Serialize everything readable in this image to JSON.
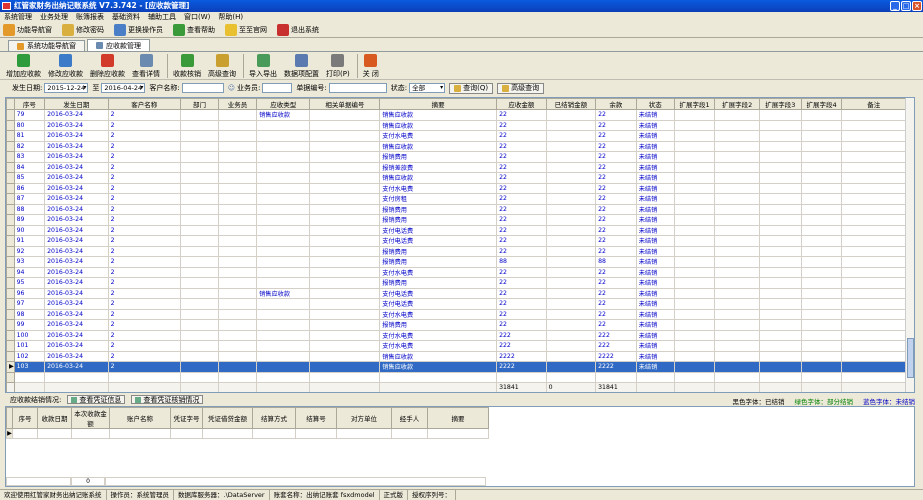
{
  "window": {
    "title": "红管家财务出纳记账系统 V7.3.742 - [应收款管理]"
  },
  "menu": [
    "系统管理",
    "业务处理",
    "账簿报表",
    "基础资料",
    "辅助工具",
    "窗口(W)",
    "帮助(H)"
  ],
  "mainbar": [
    {
      "label": "功能导航窗",
      "icon": "home-icon",
      "color": "#e39a2a"
    },
    {
      "label": "修改密码",
      "icon": "key-icon",
      "color": "#d9b040"
    },
    {
      "label": "更换操作员",
      "icon": "users-icon",
      "color": "#4a7fc8"
    },
    {
      "label": "查看帮助",
      "icon": "help-icon",
      "color": "#3a9a3a"
    },
    {
      "label": "至至官网",
      "icon": "star-icon",
      "color": "#e8c030"
    },
    {
      "label": "退出系统",
      "icon": "exit-icon",
      "color": "#c83030"
    }
  ],
  "tabs": [
    {
      "label": "系统功能导航窗",
      "icon": "home-icon",
      "active": false
    },
    {
      "label": "应收款管理",
      "icon": "document-icon",
      "active": true
    }
  ],
  "toolbar": [
    {
      "label": "增加应收款",
      "icon": "add-icon",
      "color": "#2e9c3c"
    },
    {
      "label": "修改应收款",
      "icon": "edit-icon",
      "color": "#3b7bc8"
    },
    {
      "label": "删除应收款",
      "icon": "delete-icon",
      "color": "#d23a2a"
    },
    {
      "label": "查看详情",
      "icon": "details-icon",
      "color": "#6a8ab0"
    },
    {
      "label": "收款核销",
      "icon": "writeoff-icon",
      "color": "#3a9a3a"
    },
    {
      "label": "高级查询",
      "icon": "advanced-search-icon",
      "color": "#c9a030"
    },
    {
      "label": "导入导出",
      "icon": "import-export-icon",
      "color": "#4a9a5a"
    },
    {
      "label": "数据项配置",
      "icon": "settings-icon",
      "color": "#5a7ab0"
    },
    {
      "label": "打印(P)",
      "icon": "print-icon",
      "color": "#7a7a7a"
    },
    {
      "label": "关 闭",
      "icon": "close-icon",
      "color": "#d85a20"
    }
  ],
  "filter": {
    "date_label": "发生日期:",
    "date_from": "2015-12-24",
    "to_label": "至",
    "date_to": "2016-04-24",
    "customer_label": "客户名称:",
    "customer_value": "",
    "salesperson_label": "业务员:",
    "salesperson_value": "",
    "docno_label": "单据编号:",
    "docno_value": "",
    "status_label": "状态:",
    "status_value": "全部",
    "query_btn": "查询(Q)",
    "adv_btn": "高级查询"
  },
  "grid": {
    "columns": [
      "序号",
      "发生日期",
      "客户名称",
      "部门",
      "业务员",
      "应收类型",
      "相关单据编号",
      "摘要",
      "应收金额",
      "已结销金额",
      "余款",
      "状态",
      "扩展字段1",
      "扩展字段2",
      "扩展字段3",
      "扩展字段4",
      "备注"
    ],
    "rows": [
      {
        "no": "79",
        "date": "2016-03-24",
        "cust": "2",
        "type": "销售应收款",
        "summary": "销售应收款",
        "amt": "22",
        "paid": "",
        "bal": "22",
        "status": "未结销"
      },
      {
        "no": "80",
        "date": "2016-03-24",
        "cust": "2",
        "type": "",
        "summary": "销售应收款",
        "amt": "22",
        "paid": "",
        "bal": "22",
        "status": "未结销"
      },
      {
        "no": "81",
        "date": "2016-03-24",
        "cust": "2",
        "type": "",
        "summary": "支付水电费",
        "amt": "22",
        "paid": "",
        "bal": "22",
        "status": "未结销"
      },
      {
        "no": "82",
        "date": "2016-03-24",
        "cust": "2",
        "type": "",
        "summary": "销售应收款",
        "amt": "22",
        "paid": "",
        "bal": "22",
        "status": "未结销"
      },
      {
        "no": "83",
        "date": "2016-03-24",
        "cust": "2",
        "type": "",
        "summary": "报销费用",
        "amt": "22",
        "paid": "",
        "bal": "22",
        "status": "未结销"
      },
      {
        "no": "84",
        "date": "2016-03-24",
        "cust": "2",
        "type": "",
        "summary": "报销差旅费",
        "amt": "22",
        "paid": "",
        "bal": "22",
        "status": "未结销"
      },
      {
        "no": "85",
        "date": "2016-03-24",
        "cust": "2",
        "type": "",
        "summary": "销售应收款",
        "amt": "22",
        "paid": "",
        "bal": "22",
        "status": "未结销"
      },
      {
        "no": "86",
        "date": "2016-03-24",
        "cust": "2",
        "type": "",
        "summary": "支付水电费",
        "amt": "22",
        "paid": "",
        "bal": "22",
        "status": "未结销"
      },
      {
        "no": "87",
        "date": "2016-03-24",
        "cust": "2",
        "type": "",
        "summary": "支付房租",
        "amt": "22",
        "paid": "",
        "bal": "22",
        "status": "未结销"
      },
      {
        "no": "88",
        "date": "2016-03-24",
        "cust": "2",
        "type": "",
        "summary": "报销费用",
        "amt": "22",
        "paid": "",
        "bal": "22",
        "status": "未结销"
      },
      {
        "no": "89",
        "date": "2016-03-24",
        "cust": "2",
        "type": "",
        "summary": "报销费用",
        "amt": "22",
        "paid": "",
        "bal": "22",
        "status": "未结销"
      },
      {
        "no": "90",
        "date": "2016-03-24",
        "cust": "2",
        "type": "",
        "summary": "支付电话费",
        "amt": "22",
        "paid": "",
        "bal": "22",
        "status": "未结销"
      },
      {
        "no": "91",
        "date": "2016-03-24",
        "cust": "2",
        "type": "",
        "summary": "支付电话费",
        "amt": "22",
        "paid": "",
        "bal": "22",
        "status": "未结销"
      },
      {
        "no": "92",
        "date": "2016-03-24",
        "cust": "2",
        "type": "",
        "summary": "报销费用",
        "amt": "22",
        "paid": "",
        "bal": "22",
        "status": "未结销"
      },
      {
        "no": "93",
        "date": "2016-03-24",
        "cust": "2",
        "type": "",
        "summary": "报销费用",
        "amt": "88",
        "paid": "",
        "bal": "88",
        "status": "未结销"
      },
      {
        "no": "94",
        "date": "2016-03-24",
        "cust": "2",
        "type": "",
        "summary": "支付水电费",
        "amt": "22",
        "paid": "",
        "bal": "22",
        "status": "未结销"
      },
      {
        "no": "95",
        "date": "2016-03-24",
        "cust": "2",
        "type": "",
        "summary": "报销费用",
        "amt": "22",
        "paid": "",
        "bal": "22",
        "status": "未结销"
      },
      {
        "no": "96",
        "date": "2016-03-24",
        "cust": "2",
        "type": "销售应收款",
        "summary": "支付电话费",
        "amt": "22",
        "paid": "",
        "bal": "22",
        "status": "未结销"
      },
      {
        "no": "97",
        "date": "2016-03-24",
        "cust": "2",
        "type": "",
        "summary": "支付电话费",
        "amt": "22",
        "paid": "",
        "bal": "22",
        "status": "未结销"
      },
      {
        "no": "98",
        "date": "2016-03-24",
        "cust": "2",
        "type": "",
        "summary": "支付水电费",
        "amt": "22",
        "paid": "",
        "bal": "22",
        "status": "未结销"
      },
      {
        "no": "99",
        "date": "2016-03-24",
        "cust": "2",
        "type": "",
        "summary": "报销费用",
        "amt": "22",
        "paid": "",
        "bal": "22",
        "status": "未结销"
      },
      {
        "no": "100",
        "date": "2016-03-24",
        "cust": "2",
        "type": "",
        "summary": "支付水电费",
        "amt": "222",
        "paid": "",
        "bal": "222",
        "status": "未结销"
      },
      {
        "no": "101",
        "date": "2016-03-24",
        "cust": "2",
        "type": "",
        "summary": "支付水电费",
        "amt": "222",
        "paid": "",
        "bal": "222",
        "status": "未结销"
      },
      {
        "no": "102",
        "date": "2016-03-24",
        "cust": "2",
        "type": "",
        "summary": "销售应收款",
        "amt": "2222",
        "paid": "",
        "bal": "2222",
        "status": "未结销"
      },
      {
        "no": "103",
        "date": "2016-03-24",
        "cust": "2",
        "type": "",
        "summary": "销售应收款",
        "amt": "2222",
        "paid": "",
        "bal": "2222",
        "status": "未结销"
      }
    ],
    "selected_no": "103",
    "totals": {
      "amt": "31841",
      "paid": "0",
      "bal": "31841"
    }
  },
  "sub": {
    "title": "应收款结销情况:",
    "btn1": "查看凭证信息",
    "btn2": "查看凭证核销情况",
    "legend": [
      {
        "text": "黑色字体：已结销",
        "color": "#000000"
      },
      {
        "text": "绿色字体：部分结销",
        "color": "#008000"
      },
      {
        "text": "蓝色字体：未结销",
        "color": "#0000c8"
      }
    ],
    "columns": [
      "序号",
      "收款日期",
      "本次收款金额",
      "账户名称",
      "凭证字号",
      "凭证借贷金额",
      "结算方式",
      "结算号",
      "对方单位",
      "经手人",
      "摘要"
    ],
    "total": "0"
  },
  "status": [
    "欢迎使用红管家财务出纳记账系统",
    "操作员：系统管理员",
    "数据库服务器：.\\DataServer",
    "账套名称：出纳记账套 fsxdmodel",
    "正式版",
    "授权序列号："
  ]
}
